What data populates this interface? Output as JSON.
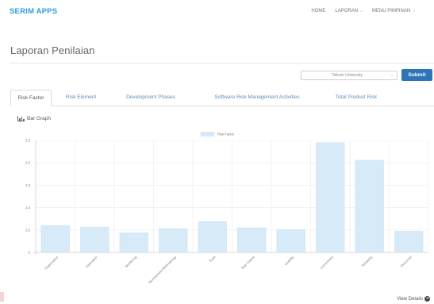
{
  "navbar": {
    "brand": "SERIM APPS",
    "items": [
      {
        "label": "HOME",
        "has_caret": false
      },
      {
        "label": "LAPORAN",
        "has_caret": true
      },
      {
        "label": "MENU PIMPINAN",
        "has_caret": true
      }
    ]
  },
  "page": {
    "title": "Laporan Penilaian"
  },
  "filter": {
    "selected": "Telkom University",
    "submit_label": "Submit"
  },
  "tabs": [
    {
      "label": "Risk Factor",
      "active": true
    },
    {
      "label": "Risk Element",
      "active": false
    },
    {
      "label": "Development Phases",
      "active": false
    },
    {
      "label": "Software Risk Management Activities",
      "active": false
    },
    {
      "label": "Total Product Risk",
      "active": false
    }
  ],
  "graph": {
    "heading": "Bar Graph"
  },
  "chart_data": {
    "type": "bar",
    "legend": "Risk Factor",
    "yticks": [
      "0",
      "0.5",
      "1.0",
      "1.5",
      "2.0",
      "2.5"
    ],
    "ylim": [
      0,
      2.5
    ],
    "categories": [
      "Organization",
      "Estimation",
      "Monitoring",
      "Development Methodology",
      "Tools",
      "Risk Culture",
      "Usability",
      "Correctness",
      "Reliability",
      "Personnel"
    ],
    "values": [
      0.6,
      0.56,
      0.44,
      0.53,
      0.69,
      0.55,
      0.51,
      2.45,
      2.06,
      0.47
    ],
    "colors": {
      "fill": "#d6eaf8",
      "stroke": "#c5e0f3",
      "grid": "#ebebeb",
      "axis": "#cccccc"
    }
  },
  "footer": {
    "view_details": "View Details"
  }
}
